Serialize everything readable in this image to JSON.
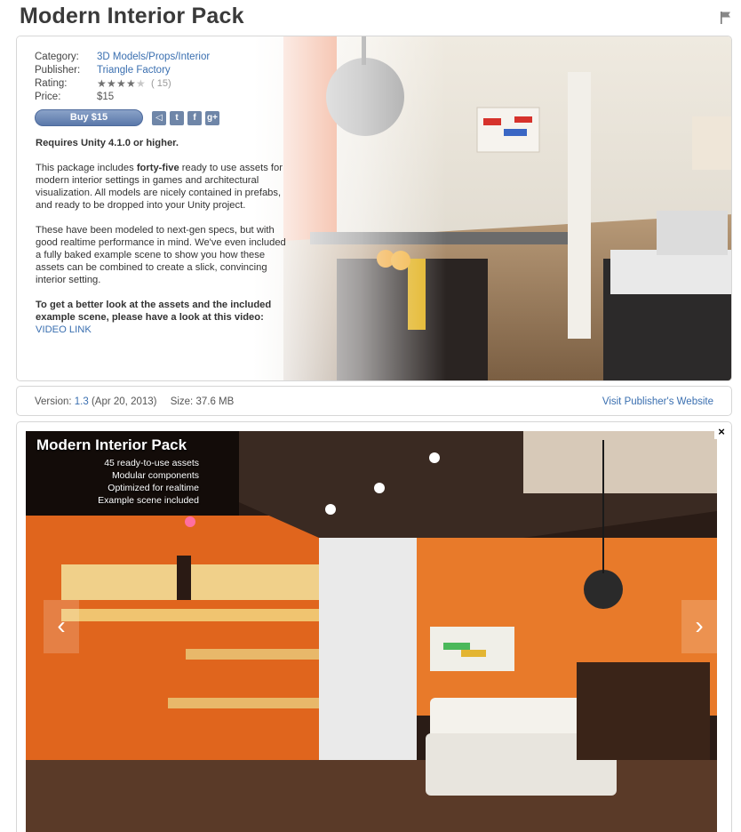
{
  "page": {
    "title": "Modern Interior Pack"
  },
  "icons": {
    "flag": "flag-icon",
    "unity": "unity-icon",
    "twitter": "twitter-icon",
    "facebook": "facebook-icon",
    "googleplus": "google-plus-icon",
    "close": "close-icon",
    "prev": "chevron-left-icon",
    "next": "chevron-right-icon"
  },
  "meta": {
    "category_label": "Category:",
    "category_value": "3D Models/Props/Interior",
    "publisher_label": "Publisher:",
    "publisher_value": "Triangle Factory",
    "rating_label": "Rating:",
    "rating_stars": 4,
    "rating_max": 5,
    "rating_count": "( 15)",
    "price_label": "Price:",
    "price_value": "$15"
  },
  "buy": {
    "label": "Buy $15"
  },
  "share": {
    "unity_glyph": "◁",
    "twitter_glyph": "t",
    "facebook_glyph": "f",
    "googleplus_glyph": "g+"
  },
  "description": {
    "requirement": "Requires Unity 4.1.0 or higher.",
    "p1_pre": "This package includes ",
    "p1_bold": "forty-five",
    "p1_post": " ready to use assets for modern interior settings in games and architectural visualization. All models are nicely contained in prefabs, and ready to be dropped into your Unity project.",
    "p2": "These have been modeled to next-gen specs, but with good realtime performance in mind. We've even included a fully baked example scene to show you how these assets can be combined to create a slick, convincing interior setting.",
    "p3_bold": "To get a better look at the assets and the included example scene, please have a look at this video:",
    "p3_link": "VIDEO LINK"
  },
  "version": {
    "version_label": "Version:",
    "version_value": "1.3",
    "version_date": "(Apr 20, 2013)",
    "size_label": "Size:",
    "size_value": "37.6 MB",
    "visit_label": "Visit Publisher's Website"
  },
  "gallery": {
    "title": "Modern Interior Pack",
    "lines": [
      "45 ready-to-use assets",
      "Modular components",
      "Optimized for realtime",
      "Example scene included"
    ],
    "close_glyph": "×",
    "prev_glyph": "‹",
    "next_glyph": "›"
  },
  "colors": {
    "link": "#3a6fb0",
    "buy_button": "#6a86b6",
    "orange_wall": "#e0651d"
  }
}
